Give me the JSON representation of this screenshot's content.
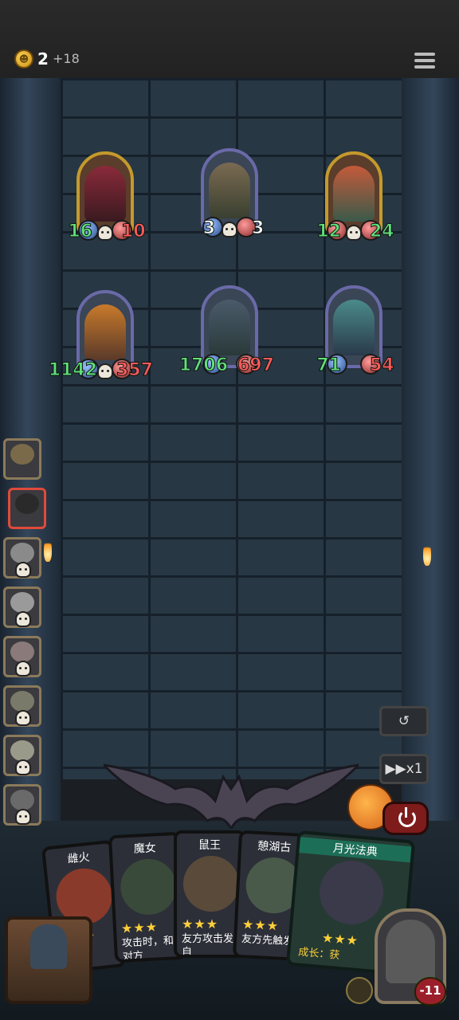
{
  "currency": {
    "amount": "2",
    "income": "+18"
  },
  "board": {
    "enemy_row": [
      {
        "name": "rabbit-mask-unit",
        "attack": "16",
        "health": "10",
        "frame": "gold"
      },
      {
        "name": "rocket-unit",
        "attack": "3",
        "health": "3",
        "frame": "silver"
      },
      {
        "name": "medusa-unit",
        "attack": "12",
        "health": "24",
        "frame": "gold"
      }
    ],
    "player_row": [
      {
        "name": "pumpkin-unit",
        "attack": "1142",
        "health": "357",
        "frame": "silver"
      },
      {
        "name": "knight-unit",
        "attack": "1706",
        "health": "697",
        "frame": "silver"
      },
      {
        "name": "ghost-unit",
        "attack": "71",
        "health": "54",
        "frame": "silver"
      }
    ]
  },
  "controls": {
    "speed_label": "▶▶x1"
  },
  "hand": [
    {
      "name": "雌火",
      "stars": "★★★",
      "desc": "",
      "type": "unit"
    },
    {
      "name": "魔女",
      "stars": "★★★",
      "desc": "攻击时，和对方",
      "type": "unit"
    },
    {
      "name": "鼠王",
      "stars": "★★★",
      "desc": "友方攻击发自",
      "type": "unit"
    },
    {
      "name": "憩湖古",
      "stars": "★★★",
      "desc": "友方先触发",
      "type": "unit"
    },
    {
      "name": "月光法典",
      "stars": "★★★",
      "desc": "成长：获",
      "type": "spell"
    }
  ],
  "player": {
    "health": "-11"
  }
}
